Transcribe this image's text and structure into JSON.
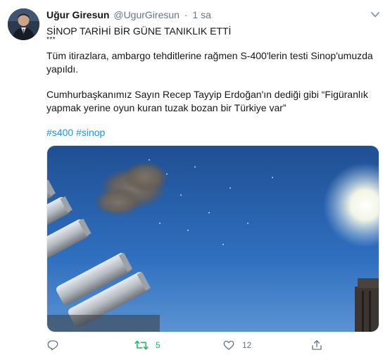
{
  "tweet": {
    "author_name": "Uğur Giresun",
    "handle": "@UgurGiresun",
    "separator": "·",
    "time": "1 sa",
    "lines": [
      "SİNOP TARİHİ BİR GÜNE TANIKLIK ETTİ",
      "Tüm itirazlara, ambargo tehditlerine rağmen S-400'lerin testi Sinop'umuzda",
      "yapıldı.",
      "Cumhurbaşkanımız Sayın Recep Tayyip Erdoğan'ın dediği gibi “Figüranlık",
      "yapmak yerine oyun kuran tuzak bozan bir Türkiye var”"
    ],
    "stars": "***",
    "hashtags": [
      "#s400",
      "#sinop"
    ],
    "retweet_count": "5",
    "like_count": "12"
  },
  "colors": {
    "link": "#1b95e0",
    "retweet_active": "#17bf63",
    "muted": "#657786"
  },
  "icons": [
    "chevron-down-icon",
    "reply-icon",
    "retweet-icon",
    "like-icon",
    "share-icon"
  ]
}
